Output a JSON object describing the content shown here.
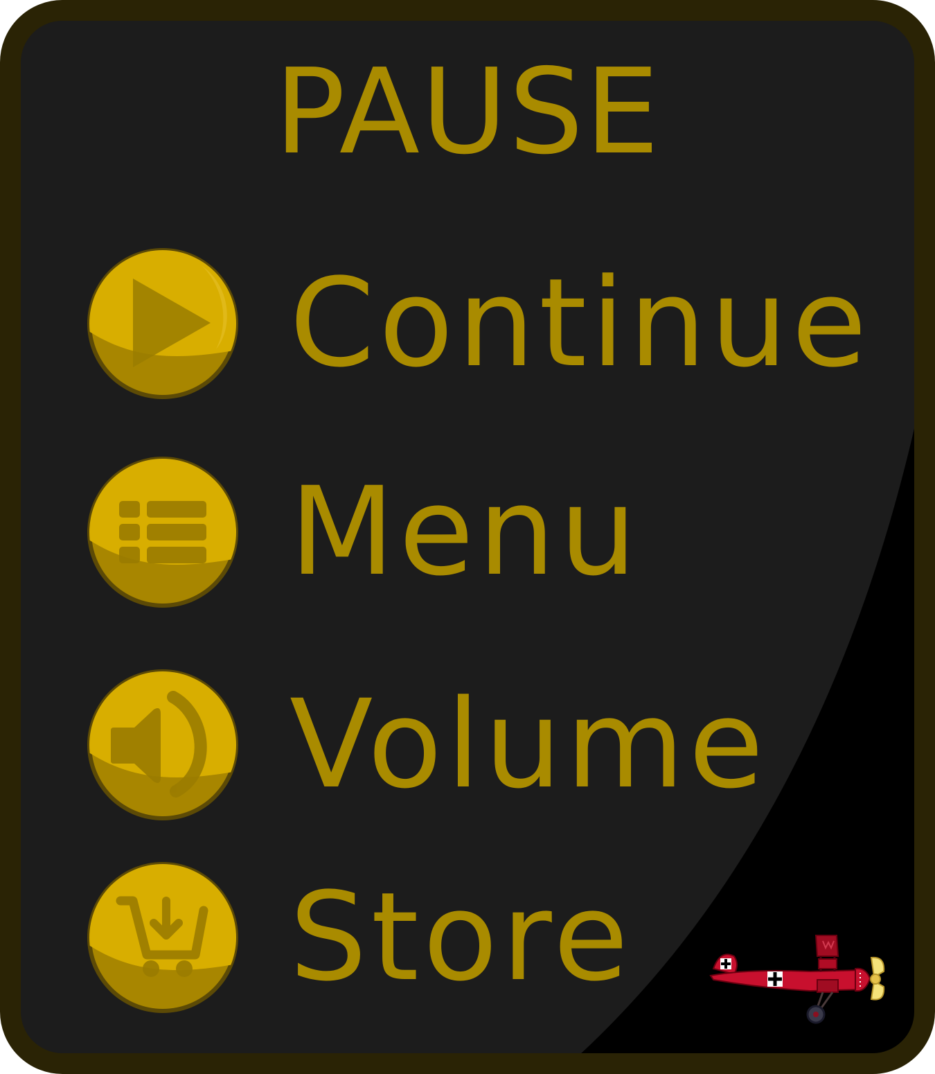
{
  "pause_menu": {
    "title": "PAUSE",
    "items": [
      {
        "label": "Continue",
        "icon": "play-icon"
      },
      {
        "label": "Menu",
        "icon": "list-icon"
      },
      {
        "label": "Volume",
        "icon": "speaker-icon"
      },
      {
        "label": "Store",
        "icon": "cart-download-icon"
      }
    ]
  },
  "colors": {
    "frame": "#2a2305",
    "panel": "#1c1c1c",
    "text_gold": "#a98b00",
    "button_gold": "#d8ae00",
    "button_dark_gold": "#a88600",
    "button_ring": "#5c4a06",
    "plane_red": "#c8102e"
  },
  "decorations": {
    "plane_icon": "red-biplane-icon"
  }
}
